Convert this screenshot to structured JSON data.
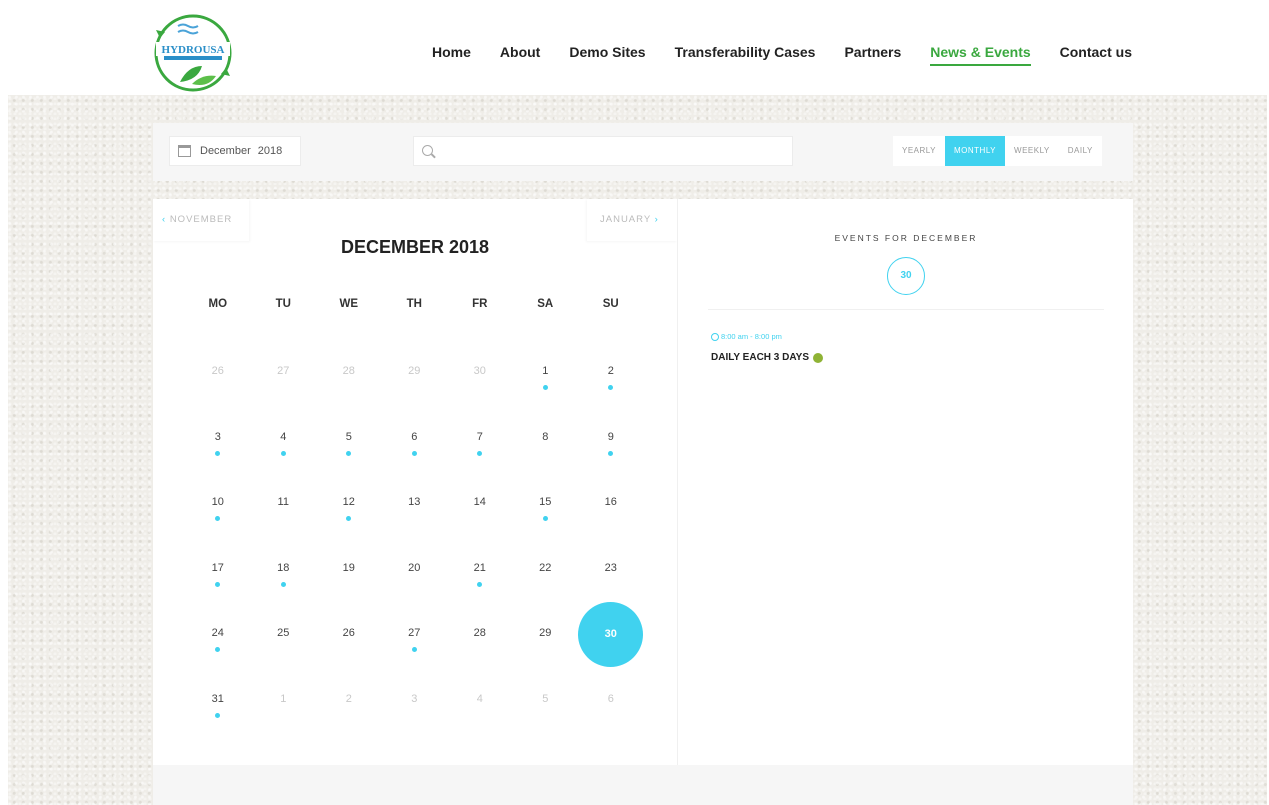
{
  "brand": {
    "logo_text": "HYDROUSA",
    "accent": "#40d2ef",
    "nav_active_color": "#3aa83f"
  },
  "nav": {
    "items": [
      {
        "label": "Home"
      },
      {
        "label": "About"
      },
      {
        "label": "Demo Sites"
      },
      {
        "label": "Transferability Cases"
      },
      {
        "label": "Partners"
      },
      {
        "label": "News & Events",
        "active": true
      },
      {
        "label": "Contact us"
      }
    ]
  },
  "toolbar": {
    "date_month": "December",
    "date_year": "2018",
    "search_placeholder": "",
    "views": [
      {
        "label": "YEARLY"
      },
      {
        "label": "MONTHLY",
        "active": true
      },
      {
        "label": "WEEKLY"
      },
      {
        "label": "DAILY"
      }
    ]
  },
  "calendar": {
    "prev_label": "NOVEMBER",
    "next_label": "JANUARY",
    "month_title": "DECEMBER 2018",
    "weekdays": [
      "MO",
      "TU",
      "WE",
      "TH",
      "FR",
      "SA",
      "SU"
    ],
    "weeks": [
      [
        {
          "d": "26",
          "other": true
        },
        {
          "d": "27",
          "other": true
        },
        {
          "d": "28",
          "other": true
        },
        {
          "d": "29",
          "other": true
        },
        {
          "d": "30",
          "other": true
        },
        {
          "d": "1",
          "dot": true
        },
        {
          "d": "2",
          "dot": true
        }
      ],
      [
        {
          "d": "3",
          "dot": true
        },
        {
          "d": "4",
          "dot": true
        },
        {
          "d": "5",
          "dot": true
        },
        {
          "d": "6",
          "dot": true
        },
        {
          "d": "7",
          "dot": true
        },
        {
          "d": "8"
        },
        {
          "d": "9",
          "dot": true
        }
      ],
      [
        {
          "d": "10",
          "dot": true
        },
        {
          "d": "11"
        },
        {
          "d": "12",
          "dot": true
        },
        {
          "d": "13"
        },
        {
          "d": "14"
        },
        {
          "d": "15",
          "dot": true
        },
        {
          "d": "16"
        }
      ],
      [
        {
          "d": "17",
          "dot": true
        },
        {
          "d": "18",
          "dot": true
        },
        {
          "d": "19"
        },
        {
          "d": "20"
        },
        {
          "d": "21",
          "dot": true
        },
        {
          "d": "22"
        },
        {
          "d": "23"
        }
      ],
      [
        {
          "d": "24",
          "dot": true
        },
        {
          "d": "25"
        },
        {
          "d": "26"
        },
        {
          "d": "27",
          "dot": true
        },
        {
          "d": "28"
        },
        {
          "d": "29"
        },
        {
          "d": "30",
          "selected": true
        }
      ],
      [
        {
          "d": "31",
          "dot": true
        },
        {
          "d": "1",
          "other": true
        },
        {
          "d": "2",
          "other": true
        },
        {
          "d": "3",
          "other": true
        },
        {
          "d": "4",
          "other": true
        },
        {
          "d": "5",
          "other": true
        },
        {
          "d": "6",
          "other": true
        }
      ]
    ]
  },
  "events": {
    "heading": "EVENTS FOR DECEMBER",
    "selected_day": "30",
    "items": [
      {
        "time": "8:00 am - 8:00 pm",
        "title": "DAILY EACH 3 DAYS",
        "color": "#8fb335"
      }
    ]
  }
}
